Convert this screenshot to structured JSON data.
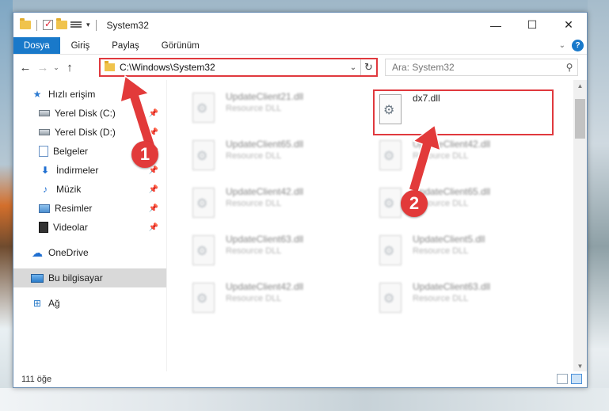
{
  "window": {
    "title": "System32",
    "controls": {
      "minimize": "—",
      "maximize": "☐",
      "close": "✕"
    }
  },
  "ribbon": {
    "tabs": [
      "Dosya",
      "Giriş",
      "Paylaş",
      "Görünüm"
    ],
    "help": "?"
  },
  "navbar": {
    "address": "C:\\Windows\\System32",
    "search_placeholder": "Ara: System32"
  },
  "sidebar": {
    "items": [
      {
        "label": "Hızlı erişim",
        "icon": "star-icon",
        "pinned": false
      },
      {
        "label": "Yerel Disk (C:)",
        "icon": "drive-icon",
        "pinned": true
      },
      {
        "label": "Yerel Disk (D:)",
        "icon": "drive-icon",
        "pinned": true
      },
      {
        "label": "Belgeler",
        "icon": "documents-icon",
        "pinned": true
      },
      {
        "label": "İndirmeler",
        "icon": "download-icon",
        "pinned": true
      },
      {
        "label": "Müzik",
        "icon": "music-icon",
        "pinned": true
      },
      {
        "label": "Resimler",
        "icon": "pictures-icon",
        "pinned": true
      },
      {
        "label": "Videolar",
        "icon": "videos-icon",
        "pinned": true
      },
      {
        "label": "OneDrive",
        "icon": "onedrive-icon",
        "pinned": false
      },
      {
        "label": "Bu bilgisayar",
        "icon": "computer-icon",
        "pinned": false,
        "selected": true
      },
      {
        "label": "Ağ",
        "icon": "network-icon",
        "pinned": false
      }
    ]
  },
  "files": [
    {
      "name": "UpdateClient21.dll",
      "type": "Resource DLL"
    },
    {
      "name": "dx7.dll",
      "type": ""
    },
    {
      "name": "UpdateClient65.dll",
      "type": "Resource DLL"
    },
    {
      "name": "UpdateClient42.dll",
      "type": "Resource DLL"
    },
    {
      "name": "UpdateClient42.dll",
      "type": "Resource DLL"
    },
    {
      "name": "UpdateClient65.dll",
      "type": "Resource DLL"
    },
    {
      "name": "UpdateClient63.dll",
      "type": "Resource DLL"
    },
    {
      "name": "UpdateClient5.dll",
      "type": "Resource DLL"
    },
    {
      "name": "UpdateClient42.dll",
      "type": "Resource DLL"
    },
    {
      "name": "UpdateClient63.dll",
      "type": "Resource DLL"
    }
  ],
  "status": {
    "count": "111 öğe"
  },
  "annotations": {
    "step1": "1",
    "step2": "2",
    "color": "#e23a3a"
  }
}
